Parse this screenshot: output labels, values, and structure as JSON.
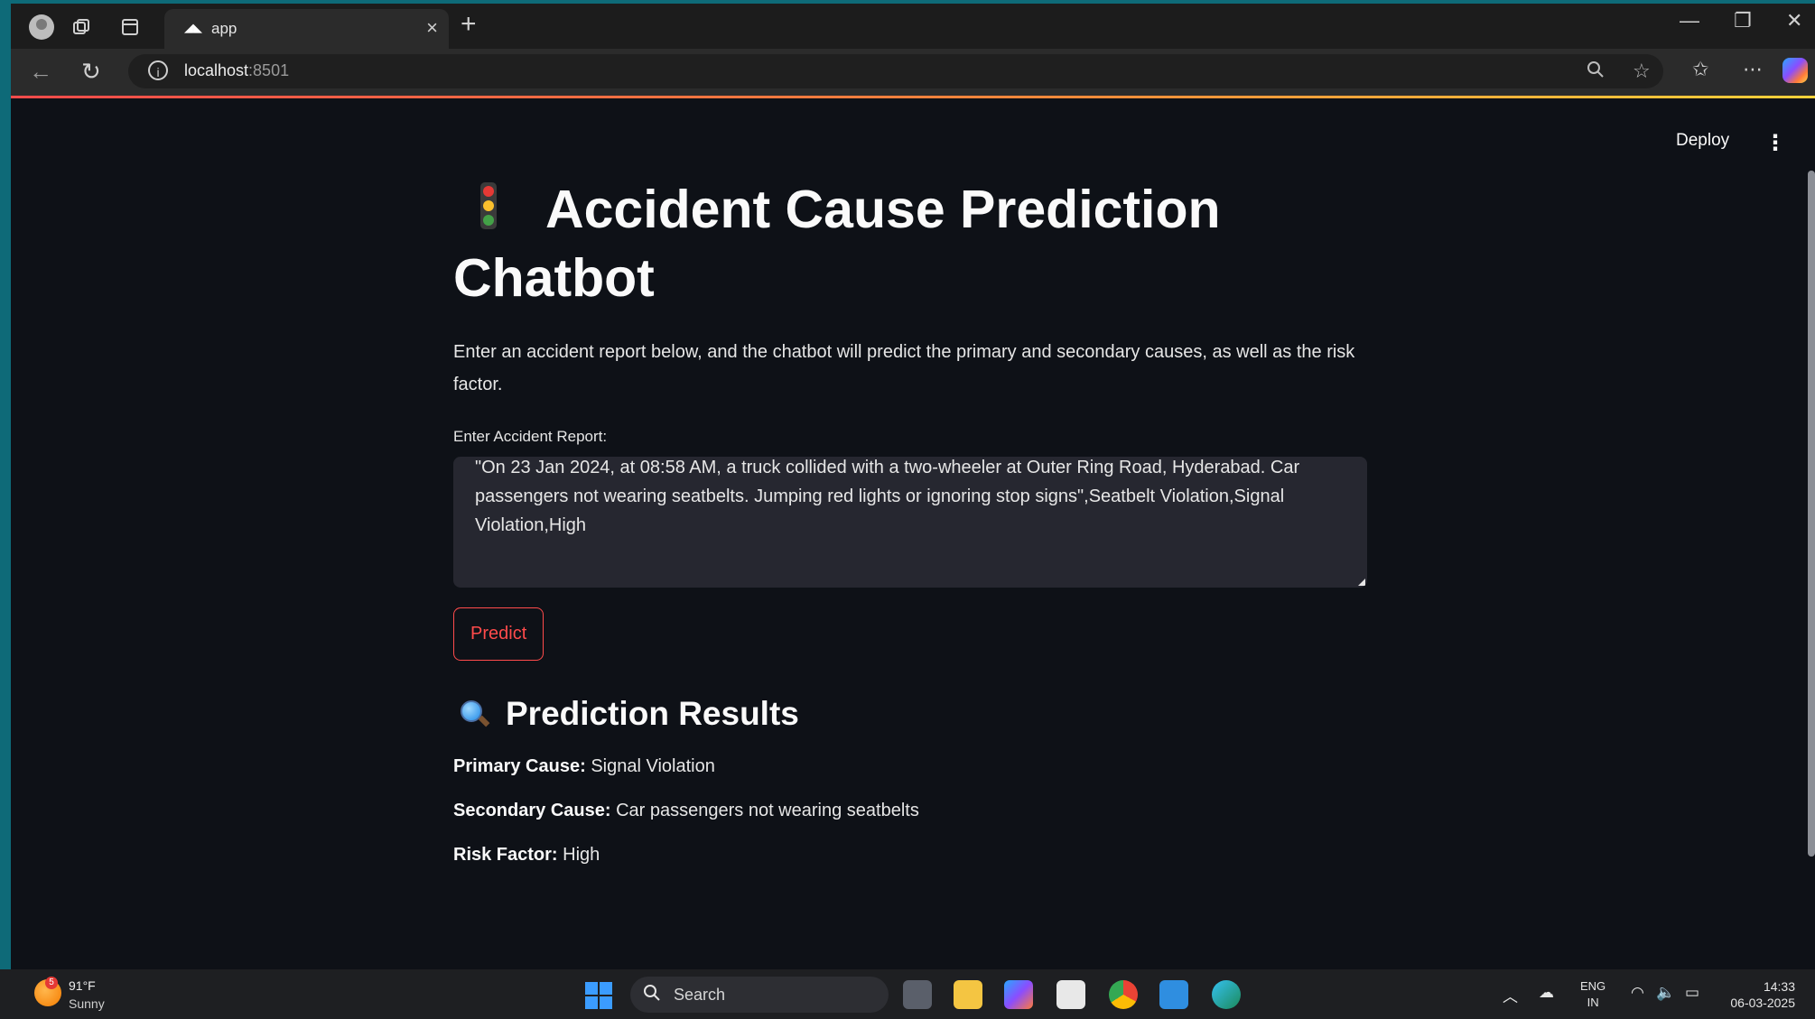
{
  "browser": {
    "tab_title": "app",
    "tab_close": "×",
    "new_tab": "+",
    "url_host": "localhost",
    "url_port": ":8501"
  },
  "app": {
    "deploy_label": "Deploy",
    "menu_glyph": "⋮",
    "title": "Accident Cause Prediction Chatbot",
    "description": "Enter an accident report below, and the chatbot will predict the primary and secondary causes, as well as the risk factor.",
    "input_label": "Enter Accident Report:",
    "input_value": "\"On 23 Jan 2024, at 08:58 AM, a truck collided with a two-wheeler at Outer Ring Road, Hyderabad. Car passengers not wearing seatbelts. Jumping red lights or ignoring stop signs\",Seatbelt Violation,Signal Violation,High",
    "predict_label": "Predict",
    "results_heading": "Prediction Results",
    "results": [
      {
        "key": "Primary Cause:",
        "value": "Signal Violation"
      },
      {
        "key": "Secondary Cause:",
        "value": "Car passengers not wearing seatbelts"
      },
      {
        "key": "Risk Factor:",
        "value": "High"
      }
    ]
  },
  "taskbar": {
    "weather_temp": "91°F",
    "weather_desc": "Sunny",
    "weather_badge": "5",
    "search_label": "Search",
    "lang_1": "ENG",
    "lang_2": "IN",
    "time": "14:33",
    "date": "06-03-2025"
  },
  "colors": {
    "accent": "#ff4b4b",
    "background": "#0e1117",
    "input_bg": "#262730"
  }
}
